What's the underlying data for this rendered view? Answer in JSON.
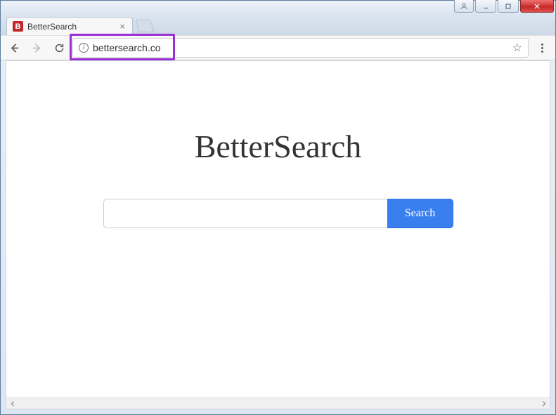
{
  "window": {
    "tab": {
      "favicon_letter": "B",
      "title": "BetterSearch"
    },
    "url": "bettersearch.co"
  },
  "page": {
    "brand": "BetterSearch",
    "search_button": "Search",
    "search_placeholder": ""
  }
}
